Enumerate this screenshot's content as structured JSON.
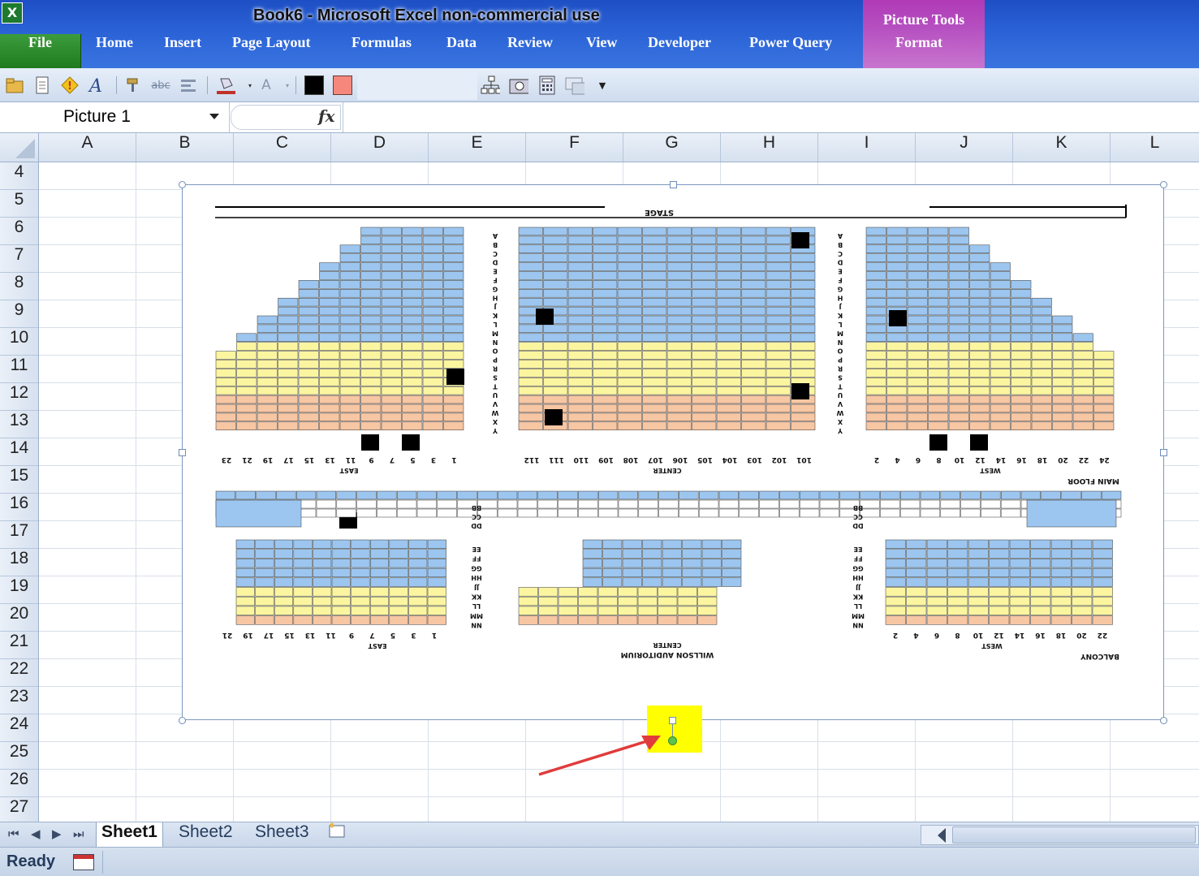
{
  "app": {
    "title": "Book6 - Microsoft Excel non-commercial use",
    "logo_icon": "excel-icon",
    "contextual_group": "Picture Tools",
    "contextual_color": "#b54fc0"
  },
  "ribbon_tabs": [
    "File",
    "Home",
    "Insert",
    "Page Layout",
    "Formulas",
    "Data",
    "Review",
    "View",
    "Developer",
    "Power Query",
    "Format"
  ],
  "toolbar": {
    "icons": [
      "open-icon",
      "new-icon",
      "info-icon",
      "spelling-icon",
      "format-painter-icon",
      "strikethrough-icon",
      "align-icon",
      "fill-color-icon",
      "font-color-icon",
      "color-black-swatch",
      "color-salmon-swatch",
      "org-chart-icon",
      "camera-icon",
      "calculator-icon",
      "chart-icon",
      "customize-dropdown-icon"
    ],
    "swatch_black": "#000000",
    "swatch_salmon": "#f6877d",
    "abc_label": "abc"
  },
  "formula_bar": {
    "name_box": "Picture 1",
    "fx": "fx",
    "value": ""
  },
  "columns": [
    "A",
    "B",
    "C",
    "D",
    "E",
    "F",
    "G",
    "H",
    "I",
    "J",
    "K",
    "L"
  ],
  "rows": [
    "4",
    "5",
    "6",
    "7",
    "8",
    "9",
    "10",
    "11",
    "12",
    "13",
    "14",
    "15",
    "16",
    "17",
    "18",
    "19",
    "20",
    "21",
    "22",
    "23",
    "24",
    "25",
    "26",
    "27"
  ],
  "picture": {
    "stage": "STAGE",
    "main_floor": "MAIN FLOOR",
    "balcony": "BALCONY",
    "east": "EAST",
    "center": "CENTER",
    "west": "WEST",
    "auditorium": "WILLSON AUDITORIUM",
    "row_letters_main": [
      "A",
      "B",
      "C",
      "D",
      "E",
      "F",
      "G",
      "H",
      "J",
      "K",
      "L",
      "M",
      "N",
      "O",
      "P",
      "R",
      "S",
      "T",
      "U",
      "V",
      "W",
      "X",
      "Y"
    ],
    "row_letters_balcony_top": [
      "BB",
      "CC",
      "DD"
    ],
    "row_letters_balcony": [
      "EE",
      "FF",
      "GG",
      "HH",
      "JJ",
      "KK",
      "LL",
      "MM",
      "NN"
    ],
    "east_seat_numbers": [
      "23",
      "21",
      "19",
      "17",
      "15",
      "13",
      "11",
      "9",
      "7",
      "5",
      "3",
      "1"
    ],
    "center_seat_numbers": [
      "112",
      "111",
      "110",
      "109",
      "108",
      "107",
      "106",
      "105",
      "104",
      "103",
      "102",
      "101"
    ],
    "west_seat_numbers": [
      "2",
      "4",
      "6",
      "8",
      "10",
      "12",
      "14",
      "16",
      "18",
      "20",
      "22",
      "24"
    ],
    "balcony_east_numbers": [
      "21",
      "19",
      "17",
      "15",
      "13",
      "11",
      "9",
      "7",
      "5",
      "3",
      "1"
    ],
    "balcony_west_numbers": [
      "2",
      "4",
      "6",
      "8",
      "10",
      "12",
      "14",
      "16",
      "18",
      "20",
      "22"
    ],
    "colors": {
      "blue": "#9cc6ef",
      "yellow": "#fbf5a0",
      "peach": "#f7c6a3",
      "white": "#ffffff"
    }
  },
  "sheets": [
    "Sheet1",
    "Sheet2",
    "Sheet3"
  ],
  "active_sheet": "Sheet1",
  "status": {
    "text": "Ready"
  },
  "annotation": {
    "highlight_color": "#ffff00",
    "arrow_color": "#e03c3c"
  }
}
